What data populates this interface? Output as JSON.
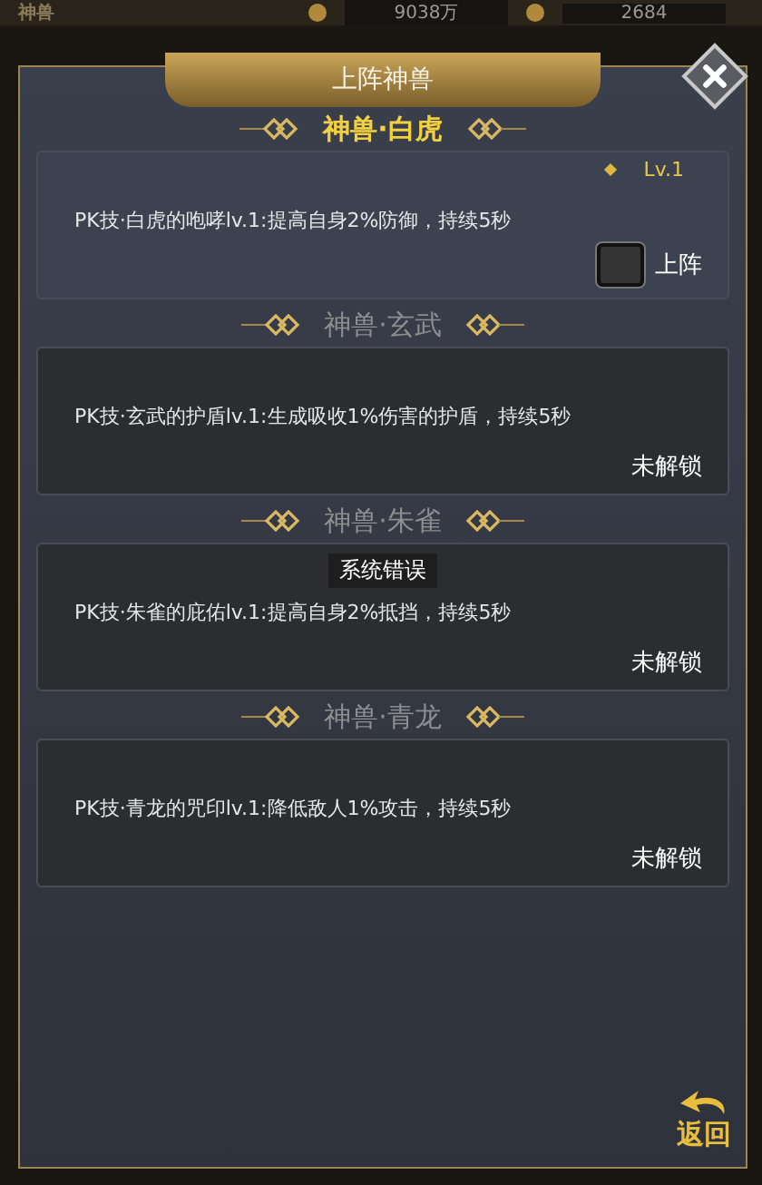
{
  "top_bar": {
    "title": "神兽",
    "gold": "9038万",
    "ingots": "2684"
  },
  "dialog": {
    "title": "上阵神兽",
    "beasts": [
      {
        "kind": "unlocked",
        "name": "神兽·白虎",
        "level": "Lv.1",
        "skill": "PK技·白虎的咆哮lv.1:提高自身2%防御，持续5秒",
        "deploy_label": "上阵",
        "checked": false
      },
      {
        "kind": "locked",
        "name": "神兽·玄武",
        "skill": "PK技·玄武的护盾lv.1:生成吸收1%伤害的护盾，持续5秒",
        "status": "未解锁"
      },
      {
        "kind": "locked",
        "name": "神兽·朱雀",
        "skill": "PK技·朱雀的庇佑lv.1:提高自身2%抵挡，持续5秒",
        "status": "未解锁"
      },
      {
        "kind": "locked",
        "name": "神兽·青龙",
        "skill": "PK技·青龙的咒印lv.1:降低敌人1%攻击，持续5秒",
        "status": "未解锁"
      }
    ],
    "toast": "系统错误",
    "back_label": "返回"
  }
}
